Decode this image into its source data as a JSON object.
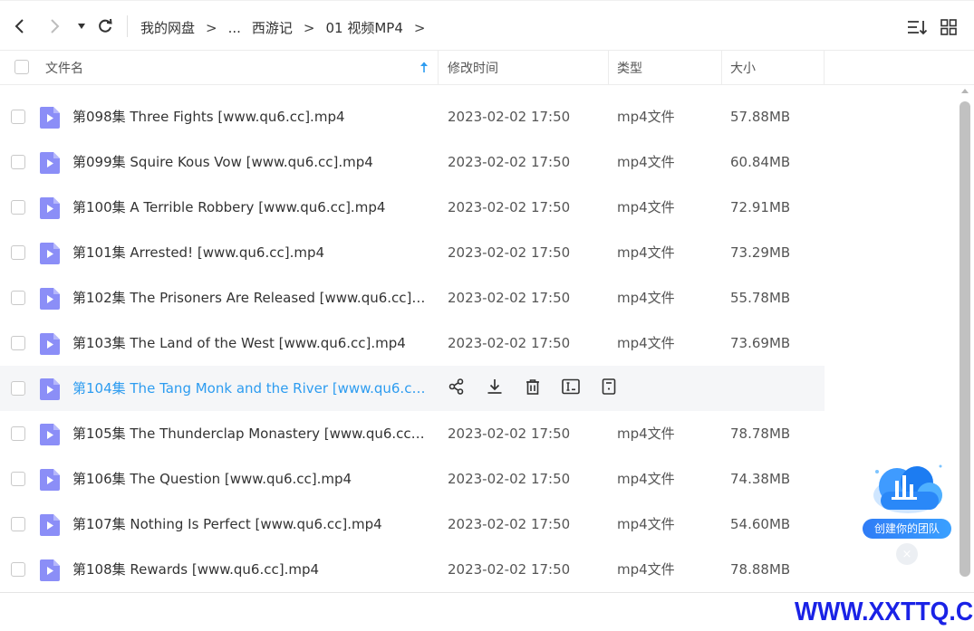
{
  "toolbar": {
    "breadcrumb": [
      "我的网盘",
      "...",
      "西游记",
      "01 视频MP4"
    ],
    "separator": ">"
  },
  "header": {
    "col_name": "文件名",
    "col_time": "修改时间",
    "col_type": "类型",
    "col_size": "大小"
  },
  "files": [
    {
      "name": "第098集  Three Fights [www.qu6.cc].mp4",
      "time": "2023-02-02 17:50",
      "type": "mp4文件",
      "size": "57.88MB"
    },
    {
      "name": "第099集  Squire Kous Vow [www.qu6.cc].mp4",
      "time": "2023-02-02 17:50",
      "type": "mp4文件",
      "size": "60.84MB"
    },
    {
      "name": "第100集  A Terrible Robbery [www.qu6.cc].mp4",
      "time": "2023-02-02 17:50",
      "type": "mp4文件",
      "size": "72.91MB"
    },
    {
      "name": "第101集  Arrested! [www.qu6.cc].mp4",
      "time": "2023-02-02 17:50",
      "type": "mp4文件",
      "size": "73.29MB"
    },
    {
      "name": "第102集  The Prisoners Are Released [www.qu6.cc]....",
      "time": "2023-02-02 17:50",
      "type": "mp4文件",
      "size": "55.78MB"
    },
    {
      "name": "第103集  The Land of the West [www.qu6.cc].mp4",
      "time": "2023-02-02 17:50",
      "type": "mp4文件",
      "size": "73.69MB"
    },
    {
      "name": "第104集  The Tang Monk and the River [www.qu6.cc...",
      "time": "",
      "type": "",
      "size": ""
    },
    {
      "name": "第105集  The Thunderclap Monastery [www.qu6.cc]....",
      "time": "2023-02-02 17:50",
      "type": "mp4文件",
      "size": "78.78MB"
    },
    {
      "name": "第106集  The Question [www.qu6.cc].mp4",
      "time": "2023-02-02 17:50",
      "type": "mp4文件",
      "size": "74.38MB"
    },
    {
      "name": "第107集  Nothing Is Perfect [www.qu6.cc].mp4",
      "time": "2023-02-02 17:50",
      "type": "mp4文件",
      "size": "54.60MB"
    },
    {
      "name": "第108集  Rewards [www.qu6.cc].mp4",
      "time": "2023-02-02 17:50",
      "type": "mp4文件",
      "size": "78.88MB"
    }
  ],
  "hover_row_index": 6,
  "hover_actions": [
    "share-icon",
    "download-icon",
    "delete-icon",
    "rename-icon",
    "more-icon"
  ],
  "team_widget": {
    "label": "创建你的团队",
    "close": "×"
  },
  "watermark": "WWW.XXTTQ.COM",
  "colors": {
    "accent": "#2d9cf0",
    "file_icon": "#8b8ef7",
    "watermark": "#1a22e6"
  }
}
